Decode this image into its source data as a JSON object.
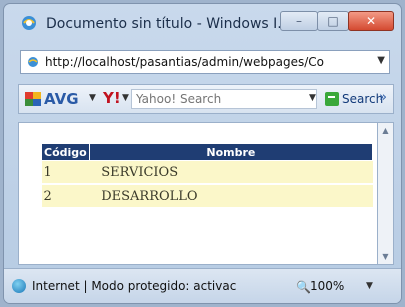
{
  "window": {
    "title": "Documento sin título - Windows I..."
  },
  "address_bar": {
    "url": "http://localhost/pasantias/admin/webpages/Co"
  },
  "toolbar": {
    "avg_label": "AVG",
    "search_placeholder": "Yahoo! Search",
    "search_label": "Search",
    "more": "»"
  },
  "table": {
    "headers": [
      "Código",
      "Nombre"
    ],
    "rows": [
      {
        "code": "1",
        "name": "SERVICIOS"
      },
      {
        "code": "2",
        "name": "DESARROLLO"
      }
    ],
    "header_bg": "#1f3d73",
    "row_bg": "#fbf7c9"
  },
  "status_bar": {
    "text": "Internet | Modo protegido: activac",
    "zoom": "100%"
  },
  "icons": {
    "app": "ie-icon",
    "page": "page-icon",
    "avg": "avg-logo",
    "yahoo": "yahoo-icon",
    "search": "search-icon",
    "status": "globe-icon",
    "zoom": "zoom-icon"
  }
}
